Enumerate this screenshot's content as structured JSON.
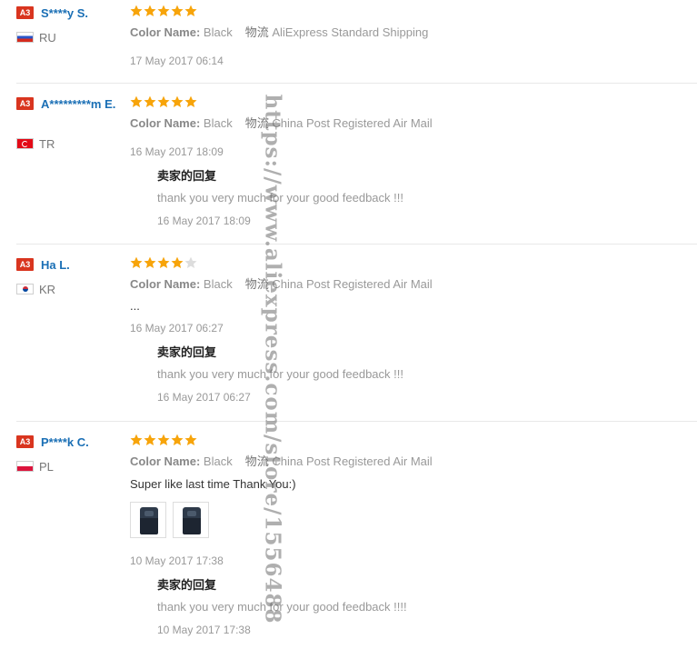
{
  "labels": {
    "color_name": "Color Name:",
    "shipping": "物流",
    "seller_reply_title": "卖家的回复"
  },
  "colors": {
    "star_on": "#f7a40a",
    "star_off": "#dddddd",
    "badge": "#d9351f",
    "username": "#1a6fb5"
  },
  "reviews": [
    {
      "badge": "A3",
      "username": "S****y S.",
      "country": "RU",
      "flag_icon": "flag-russia-icon",
      "rating": 5,
      "color": "Black",
      "shipping": "AliExpress Standard Shipping",
      "date": "17 May 2017 06:14"
    },
    {
      "badge": "A3",
      "username": "A*********m E.",
      "country": "TR",
      "flag_icon": "flag-turkey-icon",
      "rating": 5,
      "color": "Black",
      "shipping": "China Post Registered Air Mail",
      "date": "16 May 2017 18:09",
      "reply": {
        "text": "thank you very much for your good feedback !!!",
        "date": "16 May 2017 18:09"
      }
    },
    {
      "badge": "A3",
      "username": "Ha L.",
      "country": "KR",
      "flag_icon": "flag-korea-icon",
      "rating": 4,
      "color": "Black",
      "shipping": "China Post Registered Air Mail",
      "feedback": "...",
      "date": "16 May 2017 06:27",
      "reply": {
        "text": "thank you very much for your good feedback !!!",
        "date": "16 May 2017 06:27"
      }
    },
    {
      "badge": "A3",
      "username": "P****k C.",
      "country": "PL",
      "flag_icon": "flag-poland-icon",
      "rating": 5,
      "color": "Black",
      "shipping": "China Post Registered Air Mail",
      "feedback": "Super like last time Thank You:)",
      "photos": [
        "backpack-photo-thumbnail",
        "backpack-photo-thumbnail"
      ],
      "date": "10 May 2017 17:38",
      "reply": {
        "text": "thank you very much for your good feedback !!!!",
        "date": "10 May 2017 17:38"
      }
    }
  ],
  "watermark": "https://www.aliexpress.com/store/1556488"
}
